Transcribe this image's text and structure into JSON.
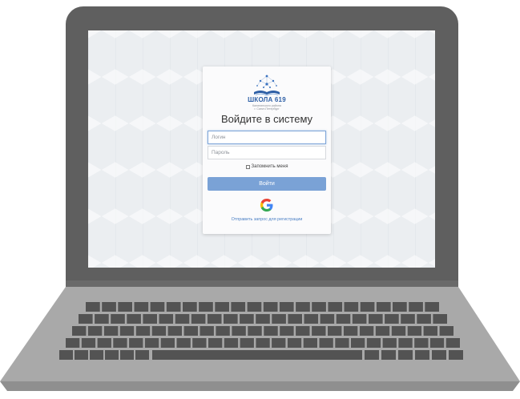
{
  "login_card": {
    "school_name": "ШКОЛА 619",
    "school_subtitle_line1": "Калининского района",
    "school_subtitle_line2": "г. Санкт-Петербург",
    "title": "Войдите в систему",
    "login_placeholder": "Логин",
    "password_placeholder": "Пароль",
    "remember_label": "Запомнить меня",
    "login_button": "Войти",
    "google_letter": "G",
    "register_link": "Отправить запрос для регистрации"
  },
  "colors": {
    "brand_blue": "#2d5fa6",
    "button_blue": "#7aa2d6",
    "link_blue": "#4a7fc4",
    "laptop_dark": "#5f5f5f",
    "laptop_base": "#a9a9a9",
    "key": "#535353"
  }
}
